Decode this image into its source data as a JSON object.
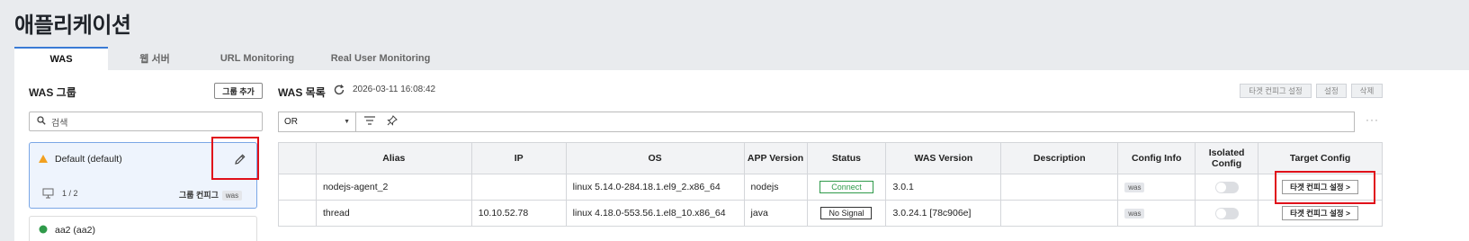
{
  "page": {
    "title": "애플리케이션"
  },
  "tabs": [
    {
      "label": "WAS",
      "active": true
    },
    {
      "label": "웹 서버"
    },
    {
      "label": "URL Monitoring"
    },
    {
      "label": "Real User Monitoring"
    }
  ],
  "groups": {
    "title": "WAS 그룹",
    "add_button": "그룹 추가",
    "search_placeholder": "검색",
    "items": [
      {
        "name": "Default (default)",
        "status": "warning",
        "count": "1 / 2",
        "config_label": "그룹 컨피그",
        "config_chip": "was"
      },
      {
        "name": "aa2 (aa2)",
        "status": "ok"
      }
    ]
  },
  "was_list": {
    "title": "WAS 목록",
    "timestamp": "2026-03-11 16:08:42",
    "buttons": {
      "target_config": "타겟 컨피그 설정",
      "settings": "설정",
      "delete": "삭제"
    },
    "filter": {
      "operator": "OR"
    },
    "columns": [
      "",
      "Alias",
      "IP",
      "OS",
      "APP Version",
      "Status",
      "WAS Version",
      "Description",
      "Config Info",
      "Isolated Config",
      "Target Config"
    ],
    "rows": [
      {
        "alias": "nodejs-agent_2",
        "ip": "",
        "os": "linux 5.14.0-284.18.1.el9_2.x86_64",
        "app": "nodejs",
        "status": "Connect",
        "was_version": "3.0.1",
        "description": "",
        "config_info": "was",
        "target_label": "타겟 컨피그 설정 >"
      },
      {
        "alias": "thread",
        "ip": "10.10.52.78",
        "os": "linux 4.18.0-553.56.1.el8_10.x86_64",
        "app": "java",
        "status": "No Signal",
        "was_version": "3.0.24.1 [78c906e]",
        "description": "",
        "config_info": "was",
        "target_label": "타겟 컨피그 설정 >"
      }
    ]
  },
  "colors": {
    "accent": "#3a7bd5",
    "highlight": "#e0101a",
    "connect": "#2f9a4a",
    "warning": "#f2a020"
  }
}
